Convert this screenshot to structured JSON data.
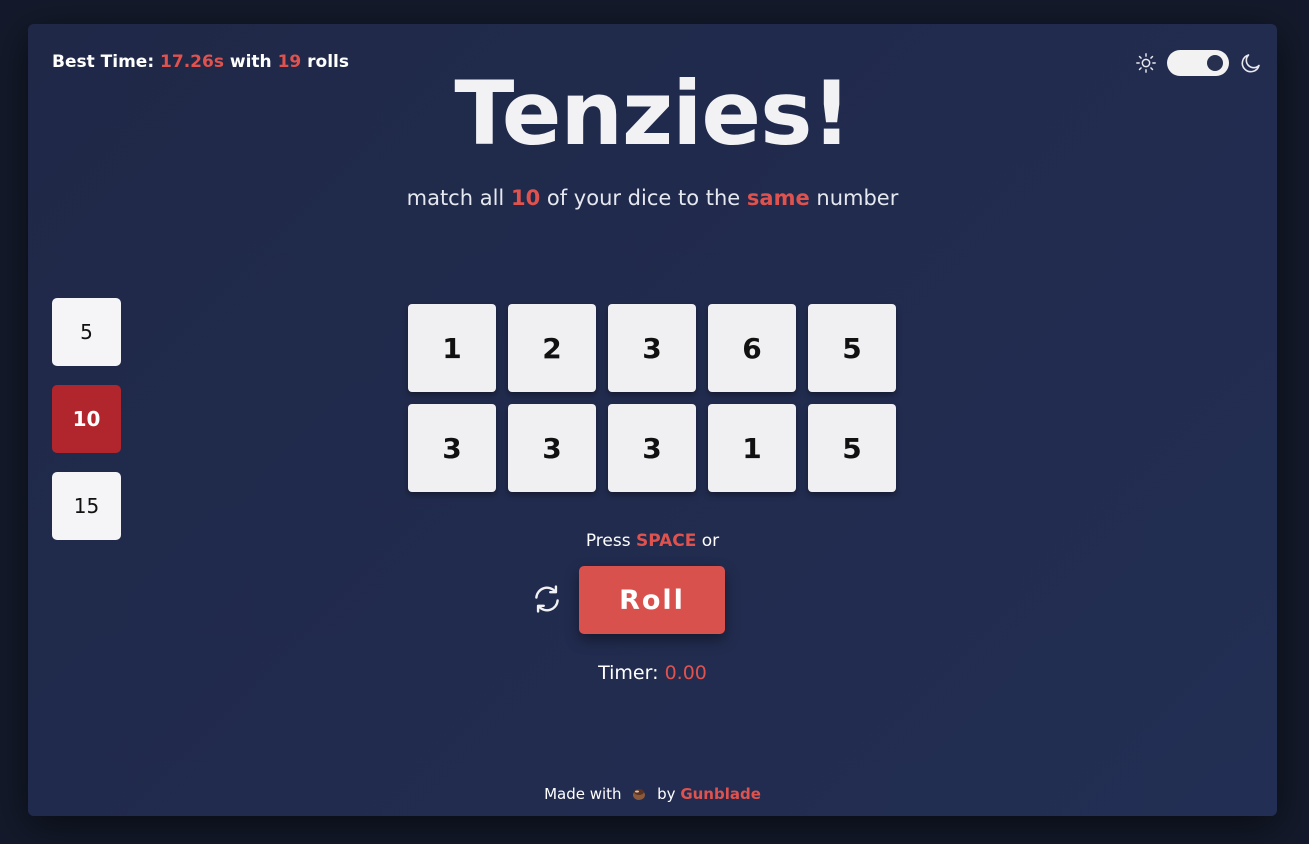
{
  "header": {
    "best_time_label": "Best Time:",
    "best_time_value": "17.26s",
    "with_label": "with",
    "best_rolls": "19",
    "rolls_label": "rolls"
  },
  "theme": {
    "sun_icon": "sun-icon",
    "moon_icon": "moon-icon",
    "mode": "dark"
  },
  "title": "Tenzies!",
  "subtitle": {
    "part1": "match all",
    "count": "10",
    "part2": "of your dice to the",
    "same": "same",
    "part3": "number"
  },
  "dice_count_options": [
    {
      "label": "5",
      "selected": false
    },
    {
      "label": "10",
      "selected": true
    },
    {
      "label": "15",
      "selected": false
    }
  ],
  "dice": [
    "1",
    "2",
    "3",
    "6",
    "5",
    "3",
    "3",
    "3",
    "1",
    "5"
  ],
  "controls": {
    "press_label": "Press",
    "key": "SPACE",
    "or_label": "or",
    "roll_label": "Roll",
    "reset_icon": "refresh-icon"
  },
  "timer": {
    "label": "Timer:",
    "value": "0.00"
  },
  "footer": {
    "made_with": "Made with",
    "icon": "coffee-icon",
    "by": "by",
    "author": "Gunblade"
  },
  "colors": {
    "accent": "#e0524e",
    "selected": "#b0262c",
    "die_face": "#f0f0f2",
    "panel": "#212a4c",
    "background": "#141a2b"
  }
}
